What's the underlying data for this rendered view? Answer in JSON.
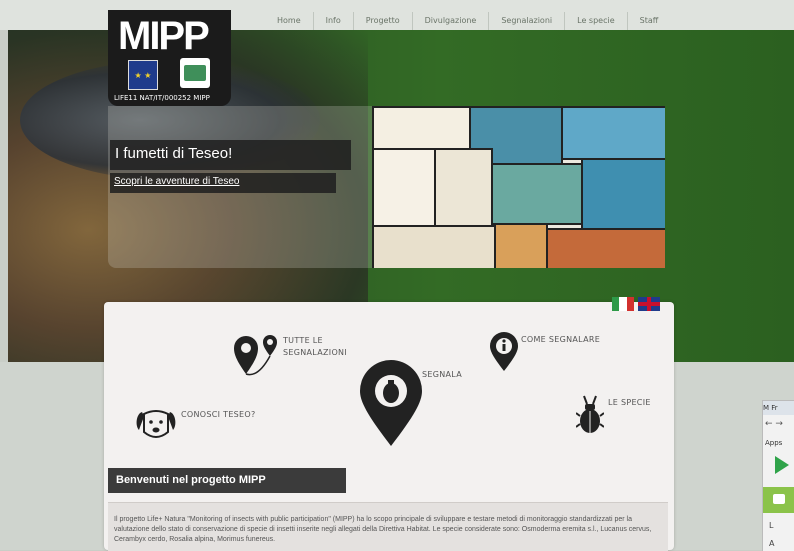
{
  "logo": {
    "text": "MIPP",
    "code": "LIFE11 NAT/IT/000252 MIPP"
  },
  "nav": [
    "Home",
    "Info",
    "Progetto",
    "Divulgazione",
    "Segnalazioni",
    "Le specie",
    "Staff"
  ],
  "hero": {
    "title": "I fumetti di Teseo!",
    "link": "Scopri le avventure di Teseo"
  },
  "menu": {
    "tutte": [
      "TUTTE LE",
      "SEGNALAZIONI"
    ],
    "come": "COME SEGNALARE",
    "segnala": "SEGNALA",
    "conosci": "CONOSCI TESEO?",
    "specie": "LE SPECIE"
  },
  "welcome": "Benvenuti nel progetto MIPP",
  "intro": "Il progetto Life+ Natura \"Monitoring of insects with public participation\" (MIPP) ha lo scopo principale di sviluppare e testare metodi di monitoraggio standardizzati per la valutazione dello stato di conservazione di specie di insetti inserite negli allegati della Direttiva Habitat. Le specie considerate sono: Osmoderma eremita s.l., Lucanus cervus, Cerambyx cerdo, Rosalia alpina, Morimus funereus.",
  "browser": {
    "tab": "M Fr",
    "nav": "← →",
    "apps": "Apps",
    "line1": "L",
    "line2": "A"
  },
  "colors": {
    "hero_green": "#336b25",
    "dark_box": "#1e1e1e",
    "card": "#f3f1f0"
  }
}
